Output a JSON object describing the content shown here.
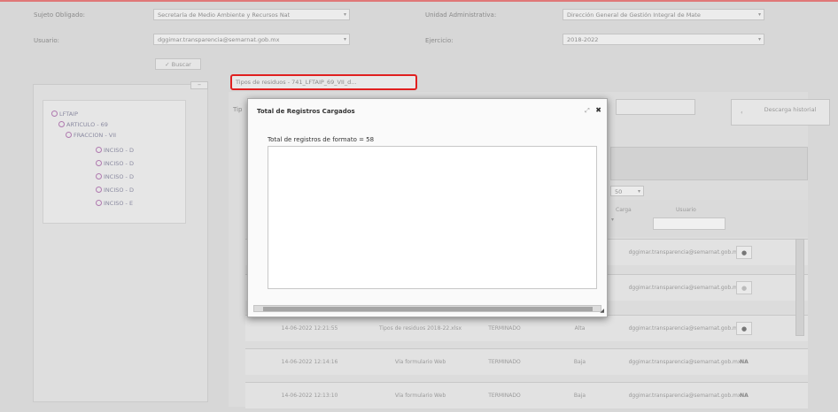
{
  "filters": {
    "sujeto_label": "Sujeto Obligado:",
    "sujeto_value": "Secretaría de Medio Ambiente y Recursos Nat",
    "unidad_label": "Unidad Administrativa:",
    "unidad_value": "Dirección General de Gestión Integral de Mate",
    "usuario_label": "Usuario:",
    "usuario_value": "dggimar.transparencia@semarnat.gob.mx",
    "ejercicio_label": "Ejercicio:",
    "ejercicio_value": "2018-2022",
    "buscar_label": "✓ Buscar"
  },
  "tree": {
    "nodes": [
      "LFTAIP",
      "ARTICULO - 69",
      "FRACCION - VII",
      "INCISO - D",
      "INCISO - D",
      "INCISO - D",
      "INCISO - D",
      "INCISO - E"
    ]
  },
  "tab": {
    "label": "Tipos de residuos - 741_LFTAIP_69_VII_d..."
  },
  "toolbar": {
    "descarga_label": "Descarga historial",
    "tipo_label": "Tip",
    "page_size": "50"
  },
  "table": {
    "headers": {
      "carga": "Carga",
      "usuario": "Usuario"
    },
    "rows": [
      {
        "fecha": "",
        "origen": "",
        "estado": "",
        "tipo": "",
        "usuario": "dggimar.transparencia@semarnat.gob.mx",
        "accion": "●"
      },
      {
        "fecha": "",
        "origen": "",
        "estado": "",
        "tipo": "",
        "usuario": "dggimar.transparencia@semarnat.gob.mx",
        "accion": "●"
      },
      {
        "fecha": "14-06-2022 12:21:55",
        "origen": "Tipos de residuos 2018-22.xlsx",
        "estado": "TERMINADO",
        "tipo": "Alta",
        "usuario": "dggimar.transparencia@semarnat.gob.mx",
        "accion": "●"
      },
      {
        "fecha": "14-06-2022 12:14:16",
        "origen": "Vía formulario Web",
        "estado": "TERMINADO",
        "tipo": "Baja",
        "usuario": "dggimar.transparencia@semarnat.gob.mx",
        "accion": "NA"
      },
      {
        "fecha": "14-06-2022 12:13:10",
        "origen": "Vía formulario Web",
        "estado": "TERMINADO",
        "tipo": "Baja",
        "usuario": "dggimar.transparencia@semarnat.gob.mx",
        "accion": "NA"
      }
    ]
  },
  "modal": {
    "title": "Total de Registros Cargados",
    "message": "Total de registros de formato = 58"
  }
}
